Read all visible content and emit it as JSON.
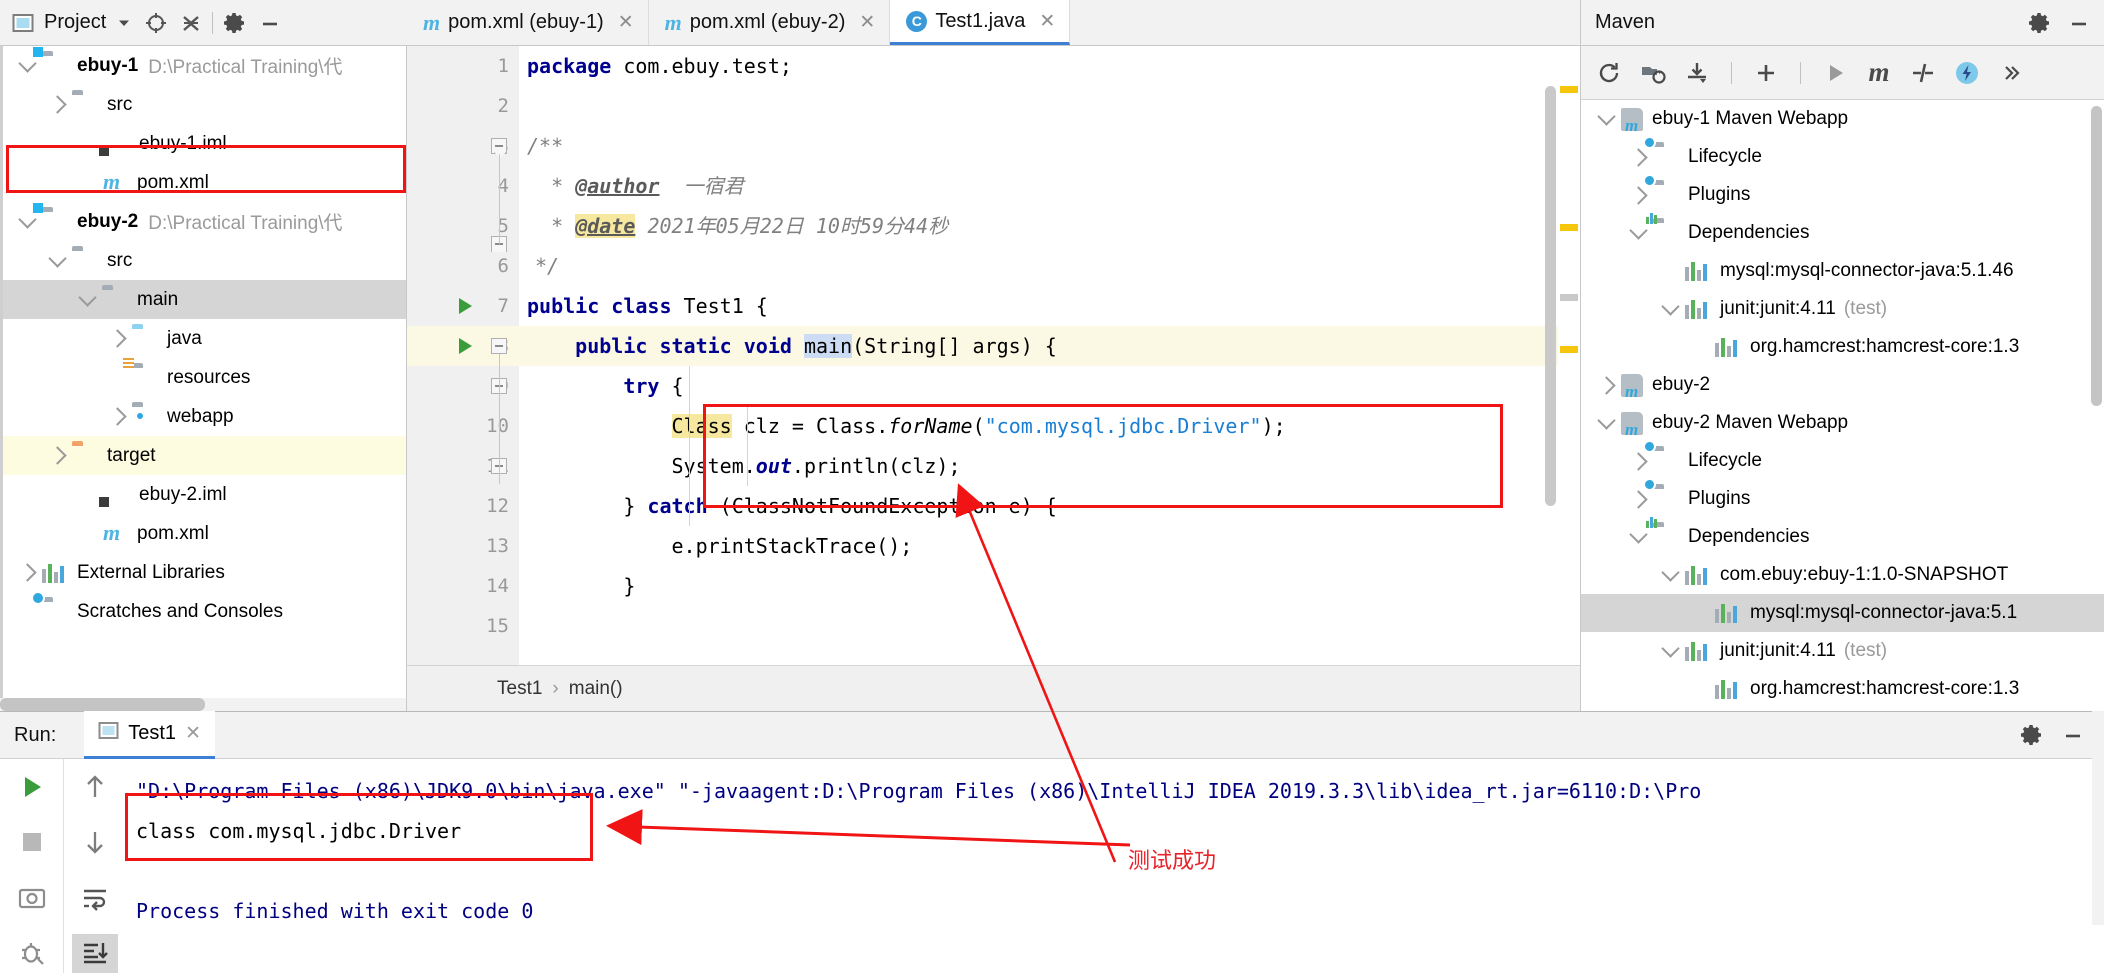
{
  "project_panel": {
    "title": "Project",
    "icons": [
      "project-view-icon",
      "locate-icon",
      "collapse-all-icon",
      "gear-icon",
      "minimize-icon"
    ],
    "tree": [
      {
        "indent": 0,
        "arrow": "down",
        "icon": "module-folder-icon",
        "label": "ebuy-1",
        "bold": true,
        "path": "D:\\Practical Training\\代"
      },
      {
        "indent": 1,
        "arrow": "right",
        "icon": "folder-icon",
        "label": "src",
        "bold": false,
        "path": ""
      },
      {
        "indent": 2,
        "arrow": "none",
        "icon": "iml-file-icon",
        "label": "ebuy-1.iml",
        "bold": false,
        "path": ""
      },
      {
        "indent": 2,
        "arrow": "none",
        "icon": "maven-pom-icon",
        "label": "pom.xml",
        "bold": false,
        "path": ""
      },
      {
        "indent": 0,
        "arrow": "down",
        "icon": "module-folder-icon",
        "label": "ebuy-2",
        "bold": true,
        "path": "D:\\Practical Training\\代"
      },
      {
        "indent": 1,
        "arrow": "down",
        "icon": "folder-icon",
        "label": "src",
        "bold": false,
        "path": ""
      },
      {
        "indent": 2,
        "arrow": "down",
        "icon": "folder-icon",
        "label": "main",
        "bold": false,
        "path": ""
      },
      {
        "indent": 3,
        "arrow": "right",
        "icon": "source-folder-icon",
        "label": "java",
        "bold": false,
        "path": ""
      },
      {
        "indent": 3,
        "arrow": "none",
        "icon": "resources-folder-icon",
        "label": "resources",
        "bold": false,
        "path": ""
      },
      {
        "indent": 3,
        "arrow": "right",
        "icon": "webapp-folder-icon",
        "label": "webapp",
        "bold": false,
        "path": ""
      },
      {
        "indent": 1,
        "arrow": "right",
        "icon": "target-folder-icon",
        "label": "target",
        "bold": false,
        "path": ""
      },
      {
        "indent": 2,
        "arrow": "none",
        "icon": "iml-file-icon",
        "label": "ebuy-2.iml",
        "bold": false,
        "path": ""
      },
      {
        "indent": 2,
        "arrow": "none",
        "icon": "maven-pom-icon",
        "label": "pom.xml",
        "bold": false,
        "path": ""
      },
      {
        "indent": 0,
        "arrow": "right",
        "icon": "library-icon",
        "label": "External Libraries",
        "bold": false,
        "path": ""
      },
      {
        "indent": 0,
        "arrow": "none",
        "icon": "scratches-icon",
        "label": "Scratches and Consoles",
        "bold": false,
        "path": ""
      }
    ]
  },
  "editor": {
    "tabs": [
      {
        "icon": "maven-pom-icon",
        "label": "pom.xml (ebuy-1)",
        "active": false,
        "closable": true
      },
      {
        "icon": "maven-pom-icon",
        "label": "pom.xml (ebuy-2)",
        "active": false,
        "closable": true
      },
      {
        "icon": "java-class-icon",
        "label": "Test1.java",
        "active": true,
        "closable": true
      }
    ],
    "line_numbers": [
      "1",
      "2",
      "3",
      "4",
      "5",
      "6",
      "7",
      "8",
      "9",
      "10",
      "11",
      "12",
      "13",
      "14",
      "15"
    ],
    "code": {
      "l1": "package com.ebuy.test;",
      "l3": "/**",
      "l4_star": "*",
      "l4_tag": "@author",
      "l4_value": "一宿君",
      "l5_star": "*",
      "l5_tag": "@date",
      "l5_value": "2021年05月22日 10时59分44秒",
      "l6": "*/",
      "l7": "public class Test1 {",
      "l8": "public static void main(String[] args) {",
      "l9": "try {",
      "l10": "Class clz = Class.forName(\"com.mysql.jdbc.Driver\");",
      "l11": "System.out.println(clz);",
      "l12": "} catch (ClassNotFoundException e) {",
      "l13": "e.printStackTrace();",
      "l14": "}"
    },
    "breadcrumb": {
      "class": "Test1",
      "separator": "›",
      "method": "main()"
    }
  },
  "maven_panel": {
    "title": "Maven",
    "toolbar_icons": [
      "reimport-icon",
      "generate-sources-icon",
      "download-sources-icon",
      "add-icon",
      "run-icon",
      "execute-maven-goal-icon",
      "toggle-skip-tests-icon",
      "show-diagram-icon",
      "more-icon"
    ],
    "header_icons": [
      "gear-icon",
      "minimize-icon"
    ],
    "tree": [
      {
        "indent": 0,
        "arrow": "down",
        "icon": "maven-project-icon",
        "label": "ebuy-1 Maven Webapp",
        "scope": "",
        "selected": false
      },
      {
        "indent": 1,
        "arrow": "right",
        "icon": "lifecycle-folder-icon",
        "label": "Lifecycle",
        "scope": "",
        "selected": false
      },
      {
        "indent": 1,
        "arrow": "right",
        "icon": "plugins-folder-icon",
        "label": "Plugins",
        "scope": "",
        "selected": false
      },
      {
        "indent": 1,
        "arrow": "down",
        "icon": "dependencies-folder-icon",
        "label": "Dependencies",
        "scope": "",
        "selected": false
      },
      {
        "indent": 2,
        "arrow": "none",
        "icon": "library-icon",
        "label": "mysql:mysql-connector-java:5.1.46",
        "scope": "",
        "selected": false
      },
      {
        "indent": 2,
        "arrow": "down",
        "icon": "library-icon",
        "label": "junit:junit:4.11",
        "scope": "(test)",
        "selected": false
      },
      {
        "indent": 3,
        "arrow": "none",
        "icon": "library-icon",
        "label": "org.hamcrest:hamcrest-core:1.3",
        "scope": "",
        "selected": false
      },
      {
        "indent": 0,
        "arrow": "right",
        "icon": "maven-project-icon",
        "label": "ebuy-2",
        "scope": "",
        "selected": false
      },
      {
        "indent": 0,
        "arrow": "down",
        "icon": "maven-project-icon",
        "label": "ebuy-2 Maven Webapp",
        "scope": "",
        "selected": false
      },
      {
        "indent": 1,
        "arrow": "right",
        "icon": "lifecycle-folder-icon",
        "label": "Lifecycle",
        "scope": "",
        "selected": false
      },
      {
        "indent": 1,
        "arrow": "right",
        "icon": "plugins-folder-icon",
        "label": "Plugins",
        "scope": "",
        "selected": false
      },
      {
        "indent": 1,
        "arrow": "down",
        "icon": "dependencies-folder-icon",
        "label": "Dependencies",
        "scope": "",
        "selected": false
      },
      {
        "indent": 2,
        "arrow": "down",
        "icon": "library-icon",
        "label": "com.ebuy:ebuy-1:1.0-SNAPSHOT",
        "scope": "",
        "selected": false
      },
      {
        "indent": 3,
        "arrow": "none",
        "icon": "library-icon",
        "label": "mysql:mysql-connector-java:5.1",
        "scope": "",
        "selected": true
      },
      {
        "indent": 2,
        "arrow": "down",
        "icon": "library-icon",
        "label": "junit:junit:4.11",
        "scope": "(test)",
        "selected": false
      },
      {
        "indent": 3,
        "arrow": "none",
        "icon": "library-icon",
        "label": "org.hamcrest:hamcrest-core:1.3",
        "scope": "",
        "selected": false
      }
    ]
  },
  "run_panel": {
    "label": "Run:",
    "tab": {
      "icon": "run-config-icon",
      "label": "Test1",
      "closable": true
    },
    "header_icons": [
      "gear-icon",
      "minimize-icon"
    ],
    "side_icons": [
      "rerun-icon",
      "up-arrow-icon",
      "stop-icon",
      "down-arrow-icon",
      "screenshot-icon",
      "soft-wrap-icon",
      "print-icon",
      "scroll-to-end-icon"
    ],
    "console_lines": [
      "\"D:\\Program Files (x86)\\JDK9.0\\bin\\java.exe\" \"-javaagent:D:\\Program Files (x86)\\IntelliJ IDEA 2019.3.3\\lib\\idea_rt.jar=6110:D:\\Pro",
      "class com.mysql.jdbc.Driver",
      "",
      "Process finished with exit code 0"
    ]
  },
  "annotations": {
    "success_text": "测试成功",
    "accent_red": "#f01414",
    "note_red": "#e8232a"
  }
}
